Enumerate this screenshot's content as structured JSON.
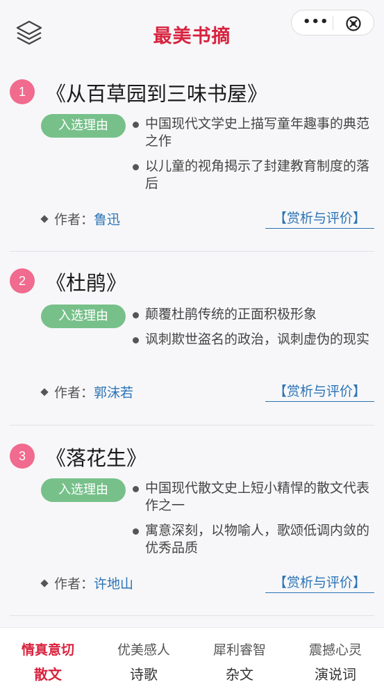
{
  "header": {
    "title": "最美书摘",
    "menu_icon": "layers-icon",
    "more_icon": "more-dots-icon",
    "close_icon": "close-circle-icon",
    "accent_color": "#d8233f"
  },
  "books": [
    {
      "index": "1",
      "title": "《从百草园到三味书屋》",
      "reason_label": "入选理由",
      "reasons": [
        "中国现代文学史上描写童年趣事的典范之作",
        "以儿童的视角揭示了封建教育制度的落后"
      ],
      "author_label": "作者：",
      "author": "鲁迅",
      "appreciate": "【赏析与评价】"
    },
    {
      "index": "2",
      "title": "《杜鹃》",
      "reason_label": "入选理由",
      "reasons": [
        "颠覆杜鹃传统的正面积极形象",
        "讽刺欺世盗名的政治，讽刺虚伪的现实"
      ],
      "author_label": "作者：",
      "author": "郭沫若",
      "appreciate": "【赏析与评价】"
    },
    {
      "index": "3",
      "title": "《落花生》",
      "reason_label": "入选理由",
      "reasons": [
        "中国现代散文史上短小精悍的散文代表作之一",
        "寓意深刻，以物喻人，歌颂低调内敛的优秀品质"
      ],
      "author_label": "作者：",
      "author": "许地山",
      "appreciate": "【赏析与评价】"
    }
  ],
  "nav": {
    "tabs": [
      {
        "sub": "情真意切",
        "main": "散文",
        "active": true
      },
      {
        "sub": "优美感人",
        "main": "诗歌",
        "active": false
      },
      {
        "sub": "犀利睿智",
        "main": "杂文",
        "active": false
      },
      {
        "sub": "震撼心灵",
        "main": "演说词",
        "active": false
      }
    ]
  }
}
